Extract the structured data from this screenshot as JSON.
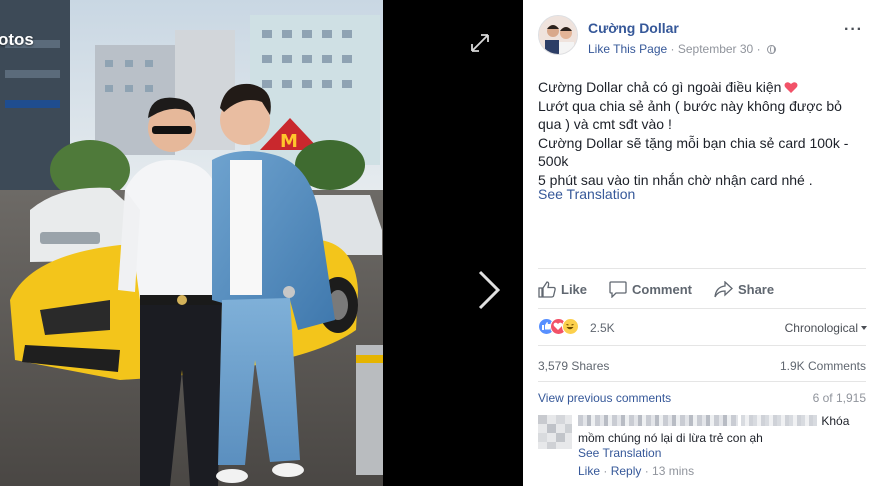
{
  "photo_viewer": {
    "label": "otos",
    "expand_icon": "expand-arrows-icon",
    "next_icon": "chevron-right-icon"
  },
  "post": {
    "page_name": "Cường Dollar",
    "like_page": "Like This Page",
    "separator": " · ",
    "date": "September 30",
    "privacy_icon": "globe-icon",
    "more_icon": "more-options-icon",
    "lines": [
      "Cường Dollar chả có gì ngoài điều kiện",
      "Lướt qua chia sẻ ảnh ( bước này không được bỏ qua ) và cmt sđt vào !",
      "Cường Dollar sẽ tặng mỗi bạn chia sẻ card 100k - 500k",
      "5 phút sau vào tin nhắn chờ nhận card nhé ."
    ],
    "see_translation": "See Translation"
  },
  "actions": {
    "like": "Like",
    "comment": "Comment",
    "share": "Share"
  },
  "stats": {
    "reaction_count": "2.5K",
    "reactions": [
      "like",
      "love",
      "haha"
    ],
    "sort_label": "Chronological",
    "shares": "3,579 Shares",
    "comments": "1.9K Comments"
  },
  "comments": {
    "view_previous": "View previous comments",
    "paging": "6 of 1,915",
    "items": [
      {
        "text_tail": "Khóa",
        "text_line2": "mồm chúng nó lại di lừa trẻ con ạh",
        "see_translation": "See Translation",
        "like": "Like",
        "reply": "Reply",
        "time": "13 mins",
        "dot": " · "
      }
    ]
  },
  "colors": {
    "link": "#365899",
    "muted": "#90949c",
    "like_blue": "#5890ff",
    "love_red": "#f25268",
    "haha_yellow": "#fcd04d"
  }
}
